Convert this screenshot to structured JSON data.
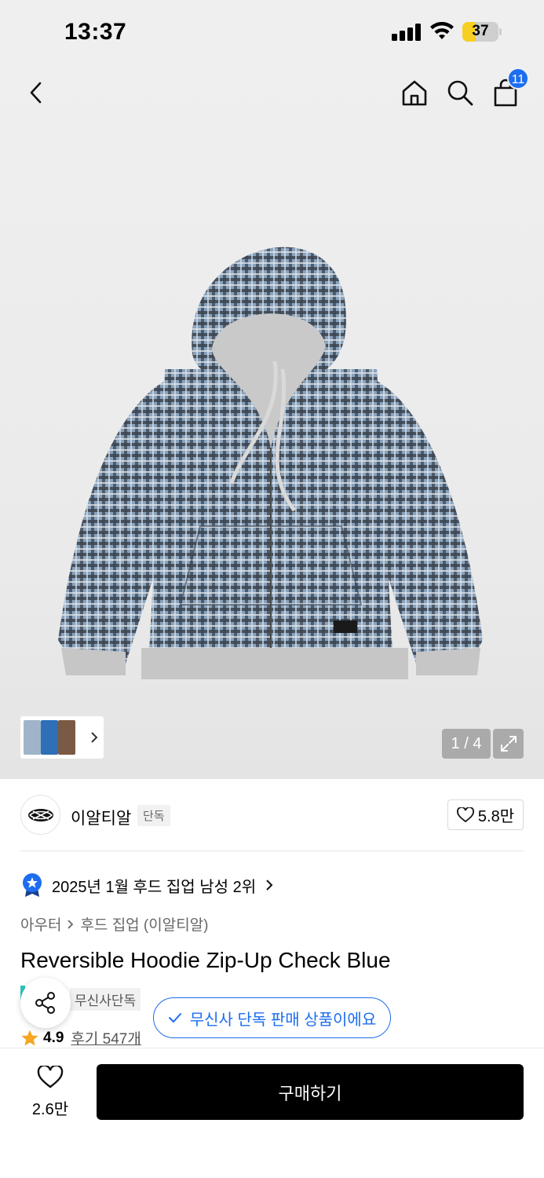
{
  "status_bar": {
    "time": "13:37",
    "battery": "37",
    "battery_level": 0.37
  },
  "header": {
    "back_icon": "chevron-left-icon",
    "home_icon": "home-icon",
    "search_icon": "search-icon",
    "cart_icon": "shopping-bag-icon",
    "cart_count": "11"
  },
  "gallery": {
    "page_counter": "1 / 4",
    "current_page": 1,
    "total_pages": 4,
    "thumb_colors": [
      "#9fb4c8",
      "#2f6fb8",
      "#7a5a44"
    ],
    "expand_icon": "expand-icon"
  },
  "brand": {
    "name": "이알티알",
    "tag": "단독",
    "likes": "5.8만"
  },
  "ranking": {
    "text": "2025년 1월 후드 집업 남성 2위"
  },
  "breadcrumb": {
    "category": "아우터",
    "subcategory": "후드 집업 (이알티알)"
  },
  "product": {
    "title": "Reversible Hoodie Zip-Up Check Blue",
    "exclusive_tag": "무신사단독",
    "exclusive_notice": "무신사 단독 판매 상품이에요",
    "rating": "4.9",
    "reviews": "후기 547개"
  },
  "bottom_bar": {
    "wish_count": "2.6만",
    "buy_label": "구매하기"
  },
  "colors": {
    "accent_blue": "#1c6df0",
    "buy_button": "#000000",
    "star": "#f5a623",
    "battery_fill": "#f6cf22"
  }
}
